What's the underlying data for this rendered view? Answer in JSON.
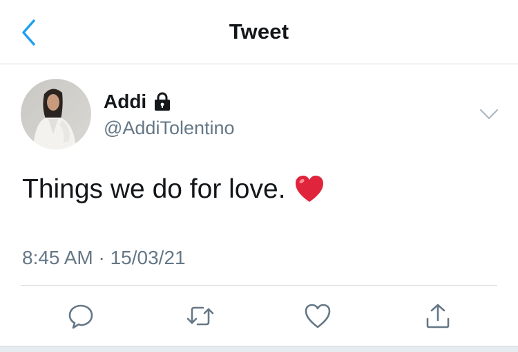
{
  "nav": {
    "title": "Tweet",
    "back_icon": "chevron-left-icon",
    "accent": "#1da1f2"
  },
  "tweet": {
    "display_name": "Addi",
    "handle": "@AddiTolentino",
    "protected_icon": "lock-icon",
    "text": "Things we do for love.",
    "emoji": "heart-emoji",
    "timestamp": "8:45 AM · 15/03/21"
  },
  "actions": [
    {
      "icon": "reply-icon"
    },
    {
      "icon": "retweet-icon"
    },
    {
      "icon": "like-icon"
    },
    {
      "icon": "share-icon"
    }
  ],
  "colors": {
    "text": "#14171a",
    "secondary": "#657786",
    "divider": "#d6d9db",
    "heart": "#e0245e"
  }
}
